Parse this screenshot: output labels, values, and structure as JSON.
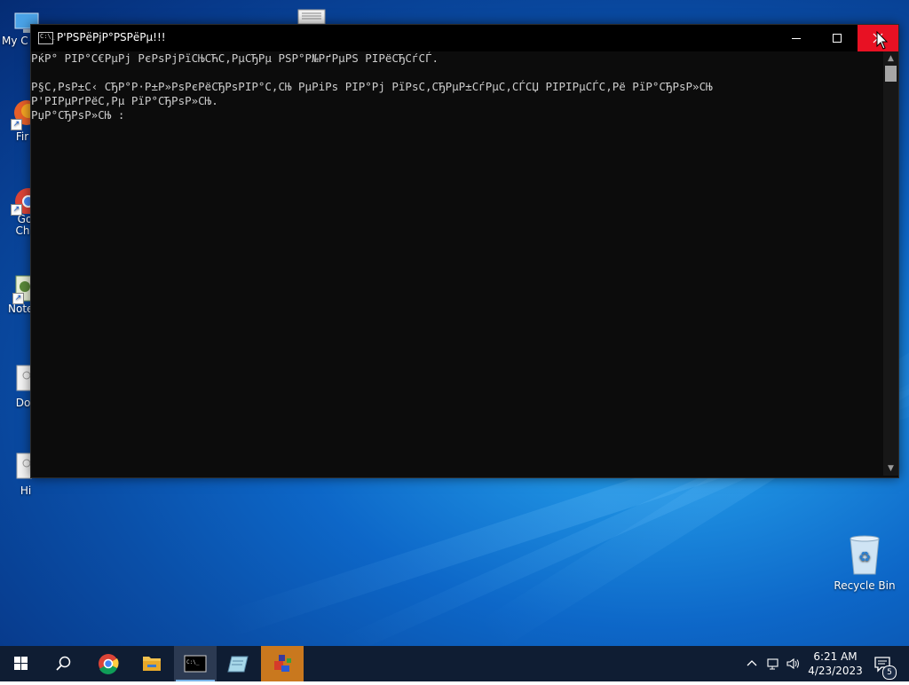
{
  "desktop": {
    "icons_left": [
      {
        "label": "My C"
      },
      {
        "label": "Fir"
      },
      {
        "label": "Go Chr"
      },
      {
        "label": "Note"
      },
      {
        "label": "Do"
      },
      {
        "label": "Hi"
      }
    ],
    "recycle_bin_label": "Recycle Bin"
  },
  "console": {
    "title": "Р'РЅРёРјР°РЅРёРµ!!!",
    "lines": [
      "РќР° РІР°С€РµРј РєРѕРјРїСЊСЋС‚РµСЂРµ РЅР°Р№РґРµРЅ РІРёСЂСѓСЃ.",
      "",
      "Р§С‚РѕР±С‹ СЂР°Р·Р±Р»РѕРєРёСЂРѕРІР°С‚СЊ РµРіРѕ РІР°Рј РїРѕС‚СЂРµР±СѓРµС‚СЃСЏ РІРІРµСЃС‚Рё РїР°СЂРѕР»СЊ",
      "Р'РІРµРґРёС‚Рµ РїР°СЂРѕР»СЊ.",
      "РџР°СЂРѕР»СЊ : "
    ]
  },
  "taskbar": {
    "clock_time": "6:21 AM",
    "clock_date": "4/23/2023",
    "notification_count": "5"
  },
  "colors": {
    "console_bg": "#0c0c0c",
    "console_text": "#cccccc",
    "close_button": "#e81123",
    "taskbar_bg": "#0f1d33"
  }
}
